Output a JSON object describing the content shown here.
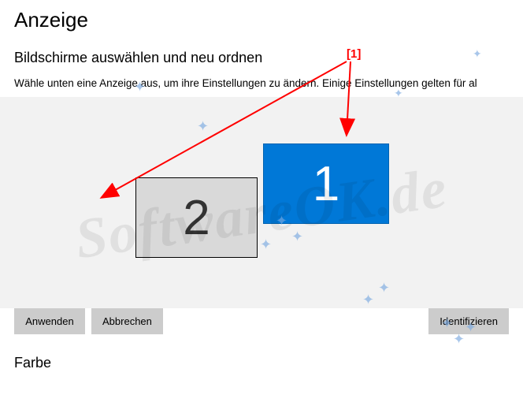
{
  "page": {
    "title": "Anzeige",
    "section_title": "Bildschirme auswählen und neu ordnen",
    "description": "Wähle unten eine Anzeige aus, um ihre Einstellungen zu ändern. Einige Einstellungen gelten für al",
    "bottom_section": "Farbe"
  },
  "monitors": {
    "m1": "1",
    "m2": "2"
  },
  "buttons": {
    "apply": "Anwenden",
    "cancel": "Abbrechen",
    "identify": "Identifizieren"
  },
  "annotation": {
    "label": "[1]"
  },
  "watermark": "SoftwareOK.de"
}
